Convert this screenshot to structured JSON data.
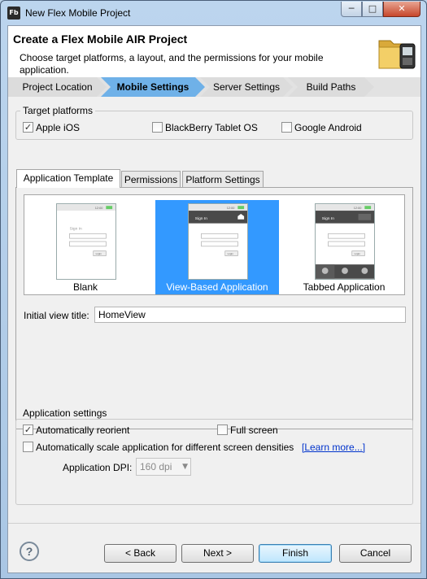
{
  "window": {
    "title": "New Flex Mobile Project",
    "icon_text": "Fb"
  },
  "header": {
    "title": "Create a Flex Mobile AIR Project",
    "description": "Choose target platforms, a layout, and the permissions for your mobile application."
  },
  "breadcrumb": [
    "Project Location",
    "Mobile Settings",
    "Server Settings",
    "Build Paths"
  ],
  "target_platforms": {
    "label": "Target platforms",
    "items": [
      {
        "label": "Apple iOS",
        "checked": true
      },
      {
        "label": "BlackBerry Tablet OS",
        "checked": false
      },
      {
        "label": "Google Android",
        "checked": false
      }
    ]
  },
  "tabs": [
    "Application Template",
    "Permissions",
    "Platform Settings"
  ],
  "templates": [
    {
      "label": "Blank",
      "selected": false
    },
    {
      "label": "View-Based Application",
      "selected": true
    },
    {
      "label": "Tabbed Application",
      "selected": false
    }
  ],
  "phone_preview": {
    "time": "12:00",
    "sign_in": "Sign In",
    "login": "Login"
  },
  "initial_view": {
    "label": "Initial view title:",
    "value": "HomeView"
  },
  "app_settings": {
    "label": "Application settings",
    "auto_reorient": "Automatically reorient",
    "full_screen": "Full screen",
    "auto_scale": "Automatically scale application for different screen densities",
    "learn_more": "[Learn more...]",
    "dpi_label": "Application DPI:",
    "dpi_value": "160 dpi"
  },
  "buttons": {
    "back": "< Back",
    "next": "Next >",
    "finish": "Finish",
    "cancel": "Cancel",
    "help": "?"
  },
  "colors": {
    "accent": "#3399ff",
    "breadcrumb_active": "#6fb1e8"
  }
}
